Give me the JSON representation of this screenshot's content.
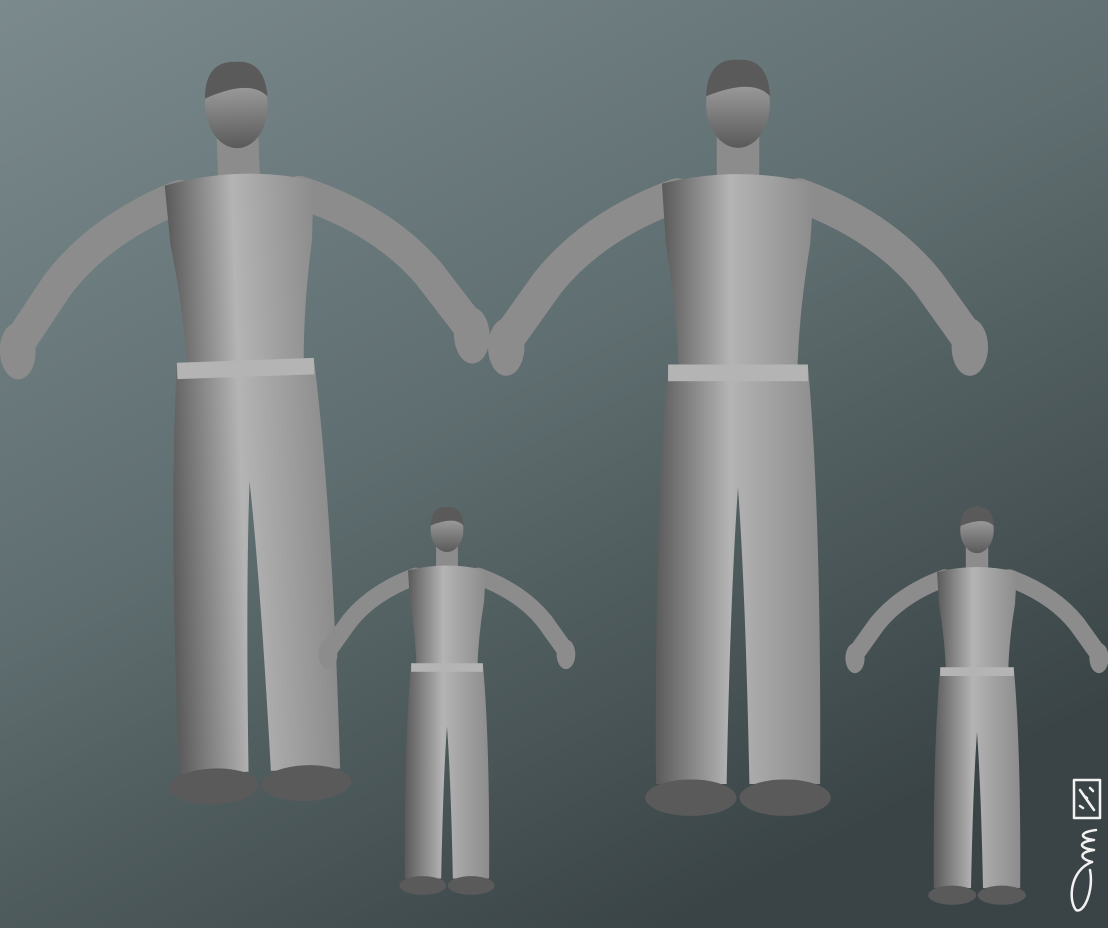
{
  "colors": {
    "background_top": "#7b8a8d",
    "background_mid": "#5f6e70",
    "background_bottom": "#3a4446",
    "clay_light": "#b4b4b4",
    "clay_mid": "#8c8c8c",
    "clay_dark": "#5a5a5a",
    "signature": "#f2f2f2"
  },
  "figures": [
    {
      "view": "front"
    },
    {
      "view": "back"
    },
    {
      "view": "front"
    },
    {
      "view": "back"
    }
  ],
  "signature": {
    "kind": "handwritten signature"
  }
}
